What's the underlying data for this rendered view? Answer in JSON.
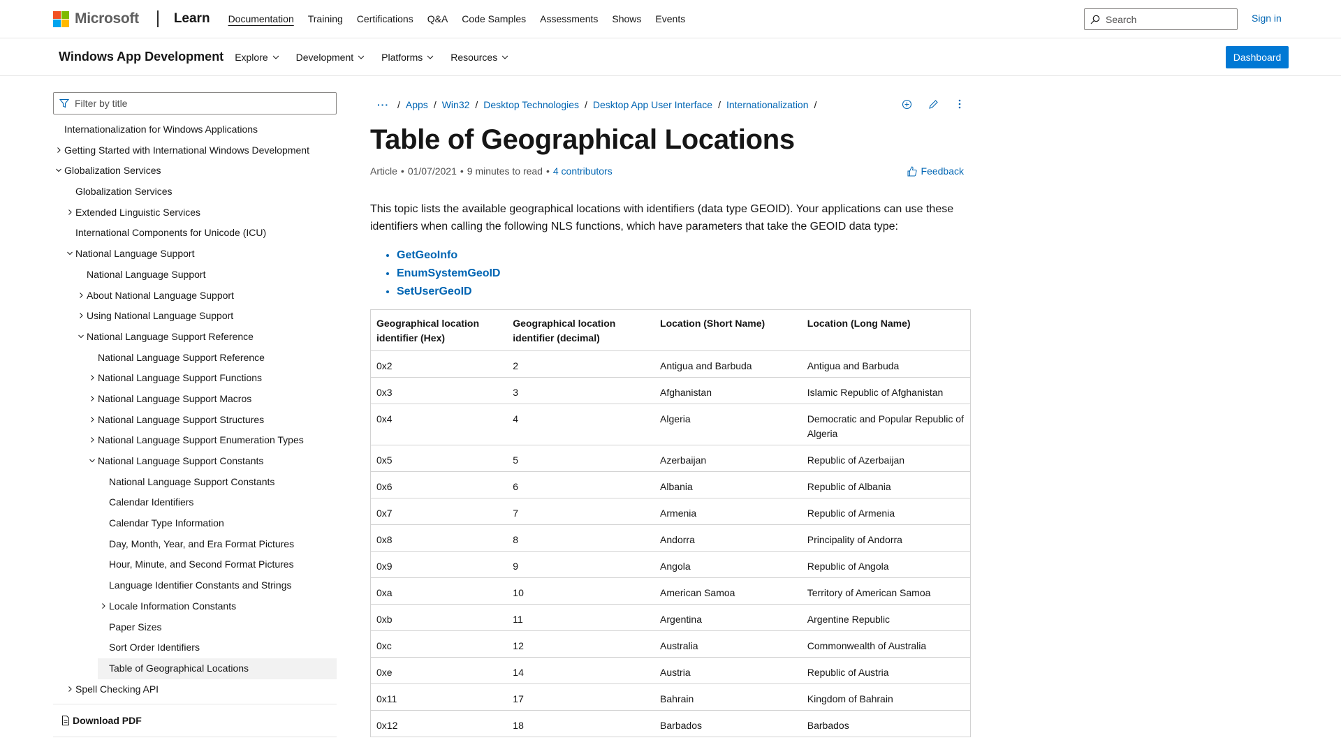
{
  "header": {
    "brand": "Microsoft",
    "product": "Learn",
    "nav": [
      "Documentation",
      "Training",
      "Certifications",
      "Q&A",
      "Code Samples",
      "Assessments",
      "Shows",
      "Events"
    ],
    "search_placeholder": "Search",
    "sign_in": "Sign in"
  },
  "product_header": {
    "title": "Windows App Development",
    "menus": [
      "Explore",
      "Development",
      "Platforms",
      "Resources"
    ],
    "dashboard": "Dashboard"
  },
  "sidebar": {
    "filter_placeholder": "Filter by title",
    "items": [
      {
        "label": "Internationalization for Windows Applications",
        "level": 0,
        "chevron": "none"
      },
      {
        "label": "Getting Started with International Windows Development",
        "level": 0,
        "chevron": "right"
      },
      {
        "label": "Globalization Services",
        "level": 0,
        "chevron": "down"
      },
      {
        "label": "Globalization Services",
        "level": 1,
        "chevron": "none"
      },
      {
        "label": "Extended Linguistic Services",
        "level": 1,
        "chevron": "right"
      },
      {
        "label": "International Components for Unicode (ICU)",
        "level": 1,
        "chevron": "none"
      },
      {
        "label": "National Language Support",
        "level": 1,
        "chevron": "down"
      },
      {
        "label": "National Language Support",
        "level": 2,
        "chevron": "none"
      },
      {
        "label": "About National Language Support",
        "level": 2,
        "chevron": "right"
      },
      {
        "label": "Using National Language Support",
        "level": 2,
        "chevron": "right"
      },
      {
        "label": "National Language Support Reference",
        "level": 2,
        "chevron": "down"
      },
      {
        "label": "National Language Support Reference",
        "level": 3,
        "chevron": "none"
      },
      {
        "label": "National Language Support Functions",
        "level": 3,
        "chevron": "right"
      },
      {
        "label": "National Language Support Macros",
        "level": 3,
        "chevron": "right"
      },
      {
        "label": "National Language Support Structures",
        "level": 3,
        "chevron": "right"
      },
      {
        "label": "National Language Support Enumeration Types",
        "level": 3,
        "chevron": "right"
      },
      {
        "label": "National Language Support Constants",
        "level": 3,
        "chevron": "down"
      },
      {
        "label": "National Language Support Constants",
        "level": 4,
        "chevron": "none"
      },
      {
        "label": "Calendar Identifiers",
        "level": 4,
        "chevron": "none"
      },
      {
        "label": "Calendar Type Information",
        "level": 4,
        "chevron": "none"
      },
      {
        "label": "Day, Month, Year, and Era Format Pictures",
        "level": 4,
        "chevron": "none"
      },
      {
        "label": "Hour, Minute, and Second Format Pictures",
        "level": 4,
        "chevron": "none"
      },
      {
        "label": "Language Identifier Constants and Strings",
        "level": 4,
        "chevron": "none"
      },
      {
        "label": "Locale Information Constants",
        "level": 4,
        "chevron": "right"
      },
      {
        "label": "Paper Sizes",
        "level": 4,
        "chevron": "none"
      },
      {
        "label": "Sort Order Identifiers",
        "level": 4,
        "chevron": "none"
      },
      {
        "label": "Table of Geographical Locations",
        "level": 4,
        "chevron": "none",
        "selected": true
      },
      {
        "label": "Spell Checking API",
        "level": 1,
        "chevron": "right"
      }
    ],
    "download_pdf": "Download PDF"
  },
  "breadcrumb": {
    "more": "···",
    "items": [
      "Apps",
      "Win32",
      "Desktop Technologies",
      "Desktop App User Interface",
      "Internationalization"
    ]
  },
  "article": {
    "title": "Table of Geographical Locations",
    "meta_type": "Article",
    "meta_date": "01/07/2021",
    "meta_read": "9 minutes to read",
    "meta_contributors": "4 contributors",
    "feedback": "Feedback",
    "intro": "This topic lists the available geographical locations with identifiers (data type GEOID). Your applications can use these identifiers when calling the following NLS functions, which have parameters that take the GEOID data type:",
    "functions": [
      "GetGeoInfo",
      "EnumSystemGeoID",
      "SetUserGeoID"
    ]
  },
  "table": {
    "headers": [
      "Geographical location identifier (Hex)",
      "Geographical location identifier (decimal)",
      "Location (Short Name)",
      "Location (Long Name)"
    ],
    "rows": [
      [
        "0x2",
        "2",
        "Antigua and Barbuda",
        "Antigua and Barbuda"
      ],
      [
        "0x3",
        "3",
        "Afghanistan",
        "Islamic Republic of Afghanistan"
      ],
      [
        "0x4",
        "4",
        "Algeria",
        "Democratic and Popular Republic of Algeria"
      ],
      [
        "0x5",
        "5",
        "Azerbaijan",
        "Republic of Azerbaijan"
      ],
      [
        "0x6",
        "6",
        "Albania",
        "Republic of Albania"
      ],
      [
        "0x7",
        "7",
        "Armenia",
        "Republic of Armenia"
      ],
      [
        "0x8",
        "8",
        "Andorra",
        "Principality of Andorra"
      ],
      [
        "0x9",
        "9",
        "Angola",
        "Republic of Angola"
      ],
      [
        "0xa",
        "10",
        "American Samoa",
        "Territory of American Samoa"
      ],
      [
        "0xb",
        "11",
        "Argentina",
        "Argentine Republic"
      ],
      [
        "0xc",
        "12",
        "Australia",
        "Commonwealth of Australia"
      ],
      [
        "0xe",
        "14",
        "Austria",
        "Republic of Austria"
      ],
      [
        "0x11",
        "17",
        "Bahrain",
        "Kingdom of Bahrain"
      ],
      [
        "0x12",
        "18",
        "Barbados",
        "Barbados"
      ]
    ]
  },
  "colors": {
    "link": "#0065b3",
    "accent": "#0078d4",
    "ms_red": "#f25022",
    "ms_green": "#7fba00",
    "ms_blue": "#00a4ef",
    "ms_yellow": "#ffb900"
  }
}
